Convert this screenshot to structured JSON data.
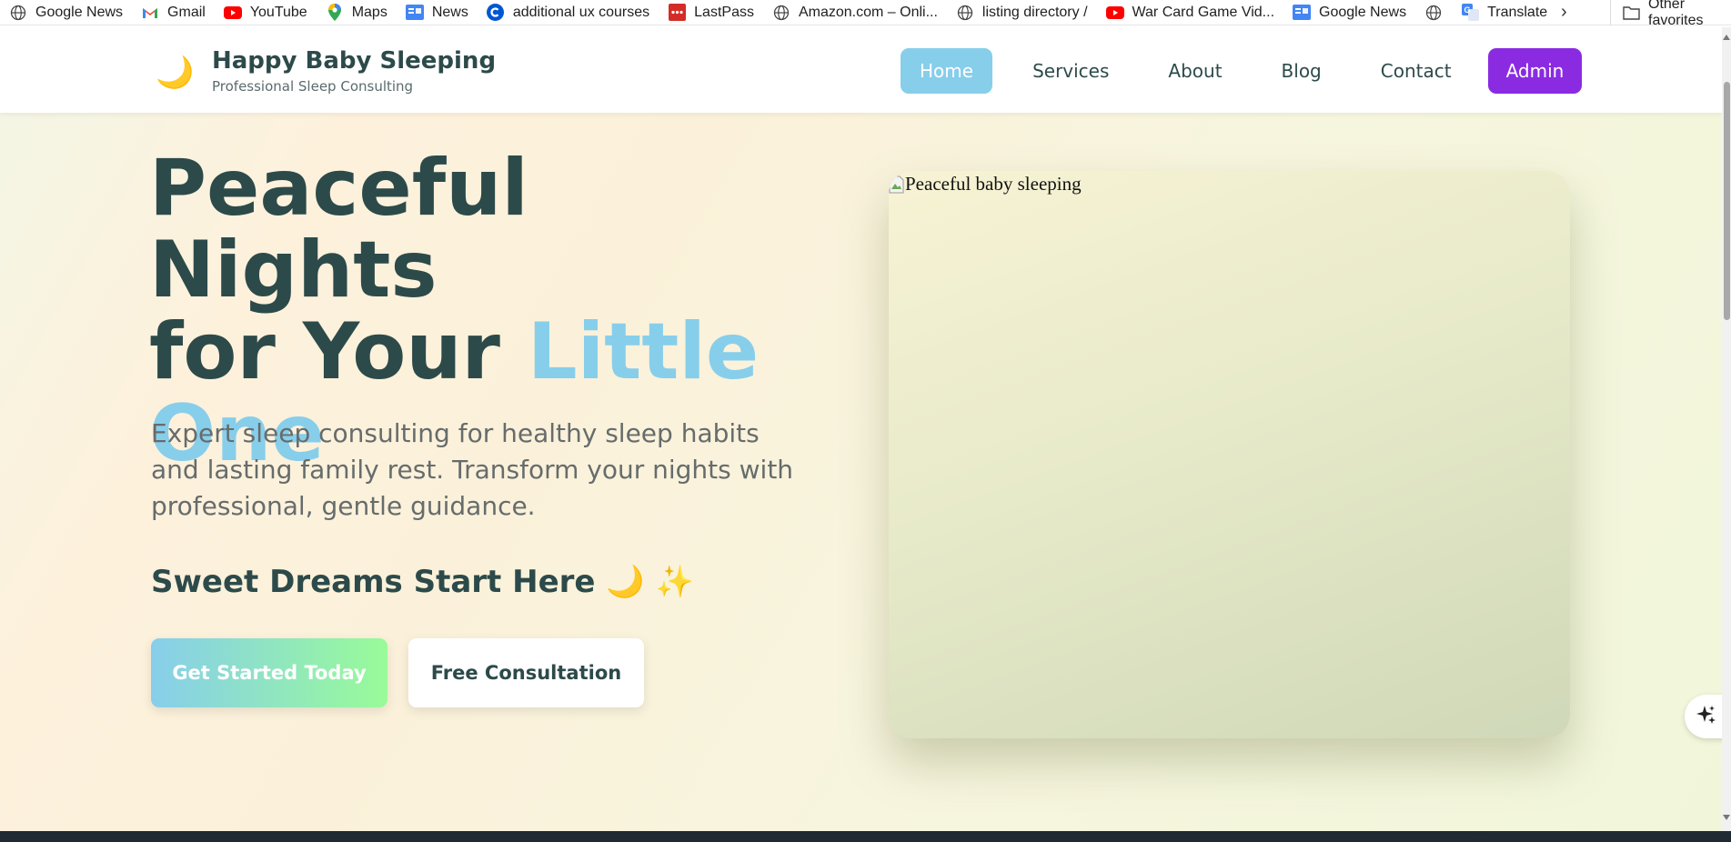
{
  "bookmarks": [
    {
      "label": "Google News",
      "icon": "globe-icon"
    },
    {
      "label": "Gmail",
      "icon": "gmail-icon"
    },
    {
      "label": "YouTube",
      "icon": "youtube-icon"
    },
    {
      "label": "Maps",
      "icon": "maps-pin-icon"
    },
    {
      "label": "News",
      "icon": "google-news-icon"
    },
    {
      "label": "additional ux courses",
      "icon": "coursera-icon"
    },
    {
      "label": "LastPass",
      "icon": "lastpass-icon"
    },
    {
      "label": "Amazon.com – Onli...",
      "icon": "globe-icon"
    },
    {
      "label": "listing directory /",
      "icon": "globe-icon"
    },
    {
      "label": "War Card Game Vid...",
      "icon": "youtube-icon"
    },
    {
      "label": "Google News",
      "icon": "google-news-icon"
    },
    {
      "label": "",
      "icon": "globe-icon"
    },
    {
      "label": "Translate",
      "icon": "translate-icon"
    }
  ],
  "bookmarks_other": "Other favorites",
  "header": {
    "logo": "🌙",
    "brand_name": "Happy Baby Sleeping",
    "brand_sub": "Professional Sleep Consulting",
    "nav": [
      "Home",
      "Services",
      "About",
      "Blog",
      "Contact"
    ],
    "admin": "Admin"
  },
  "hero": {
    "headline_1": "Peaceful Nights",
    "headline_2": "for Your ",
    "headline_highlight": "Little One",
    "description": "Expert sleep consulting for healthy sleep habits and lasting family rest. Transform your nights with professional, gentle guidance.",
    "tagline": "Sweet Dreams Start Here 🌙 ✨",
    "primary_button": "Get Started Today",
    "secondary_button": "Free Consultation",
    "image_alt": "Peaceful baby sleeping"
  },
  "colors": {
    "brand_dark": "#2d4a4a",
    "accent_sky": "#87ceeb",
    "accent_green": "#98fb98",
    "admin_purple": "#8a2be2"
  }
}
